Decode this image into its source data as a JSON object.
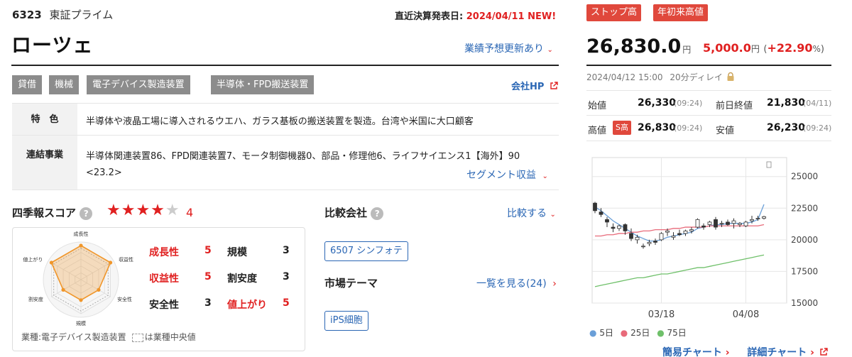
{
  "header": {
    "code": "6323",
    "market": "東証プライム",
    "settle_label": "直近決算発表日:",
    "settle_date": "2024/04/11",
    "settle_new": "NEW!",
    "company": "ローツェ",
    "forecast_link": "業績予想更新あり",
    "company_hp": "会社HP"
  },
  "tags": [
    "貸借",
    "機械",
    "電子デバイス製造装置",
    "半導体・FPD搬送装置"
  ],
  "profile": {
    "feature_label": "特　色",
    "feature_text": "半導体や液晶工場に導入されるウエハ、ガラス基板の搬送装置を製造。台湾や米国に大口顧客",
    "segment_label": "連結事業",
    "segment_text_1": "半導体関連装置86、FPD関連装置7、モータ制御機器0、部品・修理他6、ライフサイエンス1【海外】90",
    "segment_text_2": "<23.2>",
    "segment_link": "セグメント収益"
  },
  "score": {
    "title": "四季報スコア",
    "help": "?",
    "stars_on": "★★★★",
    "stars_off": "★",
    "value": "4",
    "radar_labels": [
      "成長性",
      "収益性",
      "安全性",
      "規模",
      "割安度",
      "値上がり"
    ],
    "radar_values": [
      5,
      5,
      3,
      3,
      3,
      5
    ],
    "items": [
      {
        "label": "成長性",
        "value": "5",
        "highlight": true
      },
      {
        "label": "規模",
        "value": "3",
        "highlight": false
      },
      {
        "label": "収益性",
        "value": "5",
        "highlight": true
      },
      {
        "label": "割安度",
        "value": "3",
        "highlight": false
      },
      {
        "label": "安全性",
        "value": "3",
        "highlight": false
      },
      {
        "label": "値上がり",
        "value": "5",
        "highlight": true
      }
    ],
    "industry_note": "業種:電子デバイス製造装置",
    "median_note": "は業種中央値"
  },
  "compare": {
    "title": "比較会社",
    "help": "?",
    "link": "比較する",
    "companies": [
      "6507 シンフォテ"
    ]
  },
  "theme": {
    "title": "市場テーマ",
    "link": "一覧を見る(24)",
    "items": [
      "iPS細胞"
    ]
  },
  "badges": [
    "ストップ高",
    "年初来高値"
  ],
  "price": {
    "value": "26,830.0",
    "unit": "円",
    "change": "5,000.0",
    "change_unit": "円",
    "change_pct": "+22.90",
    "pct_unit": "%",
    "paren_open": "(",
    "paren_close": ")",
    "datetime": "2024/04/12 15:00",
    "delay": "20分ディレイ"
  },
  "prices": {
    "open_label": "始値",
    "open": "26,330",
    "open_time": "(09:24)",
    "prev_label": "前日終値",
    "prev": "21,830",
    "prev_time": "(04/11)",
    "high_label": "高値",
    "high_badge": "S高",
    "high": "26,830",
    "high_time": "(09:24)",
    "low_label": "安値",
    "low": "26,230",
    "low_time": "(09:24)"
  },
  "chart_data": {
    "type": "candlestick",
    "x_ticks": [
      "03/18",
      "04/08"
    ],
    "y_ticks": [
      "25000",
      "22500",
      "20000",
      "17500",
      "15000"
    ],
    "ylim": [
      15000,
      26500
    ],
    "grid": true,
    "candles": [
      [
        22900,
        23000,
        22100,
        22300
      ],
      [
        22200,
        22500,
        21800,
        22000
      ],
      [
        21600,
        21800,
        21000,
        21400
      ],
      [
        21000,
        21300,
        20600,
        20900
      ],
      [
        20900,
        21200,
        20700,
        21100
      ],
      [
        21200,
        21300,
        20400,
        20700
      ],
      [
        20500,
        20900,
        19900,
        20100
      ],
      [
        20000,
        20400,
        19700,
        20200
      ],
      [
        19500,
        19700,
        19300,
        19500
      ],
      [
        19700,
        20000,
        19500,
        19800
      ],
      [
        19900,
        20100,
        19600,
        19800
      ],
      [
        20000,
        20600,
        19900,
        20500
      ],
      [
        20600,
        20900,
        20300,
        20700
      ],
      [
        20200,
        20600,
        20000,
        20300
      ],
      [
        20500,
        20800,
        20300,
        20400
      ],
      [
        20500,
        20800,
        20300,
        20700
      ],
      [
        20700,
        21000,
        20500,
        20800
      ],
      [
        21000,
        21700,
        20900,
        21600
      ],
      [
        21100,
        21300,
        20800,
        21000
      ],
      [
        21200,
        21500,
        21000,
        21400
      ],
      [
        21600,
        21800,
        20800,
        21000
      ],
      [
        21300,
        21500,
        21000,
        21300
      ],
      [
        21400,
        21600,
        21100,
        21200
      ],
      [
        21300,
        21700,
        20900,
        21500
      ],
      [
        21200,
        21400,
        21000,
        21300
      ],
      [
        21100,
        21500,
        21000,
        21400
      ],
      [
        21500,
        21900,
        21300,
        21600
      ],
      [
        21700,
        21900,
        21500,
        21700
      ],
      [
        21700,
        21900,
        21600,
        21830
      ]
    ],
    "series": [
      {
        "name": "5日",
        "color": "#6a9fd8",
        "values": [
          22600,
          22300,
          21900,
          21500,
          21200,
          20900,
          20600,
          20300,
          20100,
          19900,
          19900,
          20000,
          20200,
          20300,
          20400,
          20500,
          20600,
          20900,
          21000,
          21100,
          21200,
          21200,
          21300,
          21300,
          21300,
          21300,
          21400,
          21600,
          22800
        ]
      },
      {
        "name": "25日",
        "color": "#e86a7a",
        "values": [
          20300,
          20300,
          20400,
          20400,
          20500,
          20500,
          20600,
          20600,
          20700,
          20700,
          20800,
          20800,
          20800,
          20900,
          20900,
          21000,
          21000,
          21000,
          21000,
          21100,
          21100,
          21100,
          21100,
          21100,
          21100,
          21100,
          21100,
          21100,
          21200
        ]
      },
      {
        "name": "75日",
        "color": "#6fc06a",
        "values": [
          16300,
          16400,
          16500,
          16600,
          16700,
          16800,
          16900,
          17000,
          17000,
          17100,
          17200,
          17300,
          17300,
          17400,
          17500,
          17600,
          17700,
          17800,
          17800,
          17900,
          18000,
          18100,
          18200,
          18300,
          18400,
          18500,
          18600,
          18700,
          18800
        ]
      }
    ],
    "legend_dot": "●"
  },
  "chart_links": {
    "simple": "簡易チャート",
    "detail": "詳細チャート"
  },
  "colors": {
    "accent_red": "#e02020",
    "link_blue": "#2a66b4",
    "tag_gray": "#8c8c8c",
    "radar_orange": "#f0962a"
  }
}
